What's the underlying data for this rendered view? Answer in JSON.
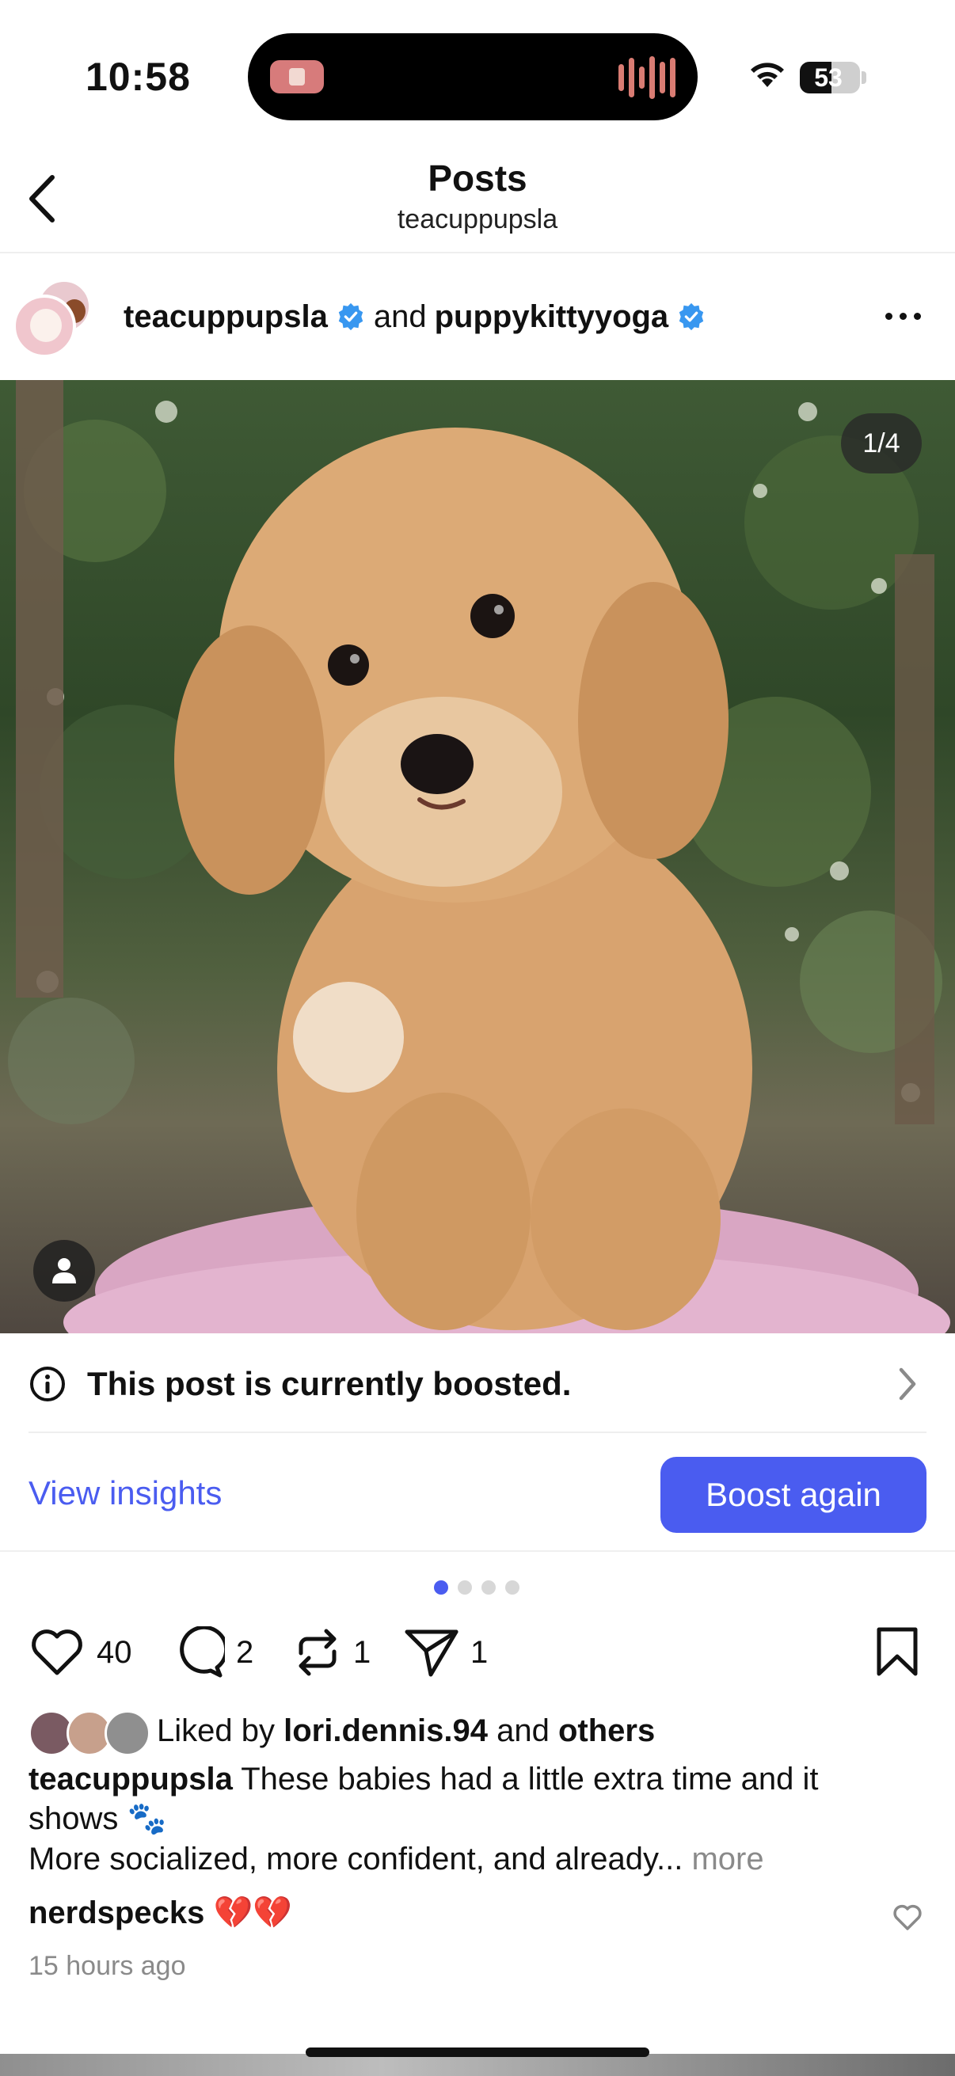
{
  "status": {
    "time": "10:58",
    "battery": "53"
  },
  "nav": {
    "title": "Posts",
    "subtitle": "teacuppupsla"
  },
  "post": {
    "author1": "teacuppupsla",
    "joiner": "and",
    "author2": "puppykittyyoga",
    "image_counter": "1/4"
  },
  "boost": {
    "banner": "This post is currently boosted.",
    "view_insights": "View insights",
    "boost_again": "Boost again"
  },
  "actions": {
    "likes": "40",
    "comments": "2",
    "reposts": "1",
    "shares": "1"
  },
  "liked_by": {
    "prefix": "Liked by",
    "user": "lori.dennis.94",
    "joiner": "and",
    "others": "others"
  },
  "caption": {
    "user": "teacuppupsla",
    "text": "These babies had a little extra time and it shows 🐾",
    "line2": "More socialized, more confident, and already...",
    "more": "more"
  },
  "comment": {
    "user": "nerdspecks",
    "text": "💔💔"
  },
  "timestamp": "15 hours ago",
  "colors": {
    "accent": "#4a5cf0",
    "verified": "#3897f0"
  }
}
